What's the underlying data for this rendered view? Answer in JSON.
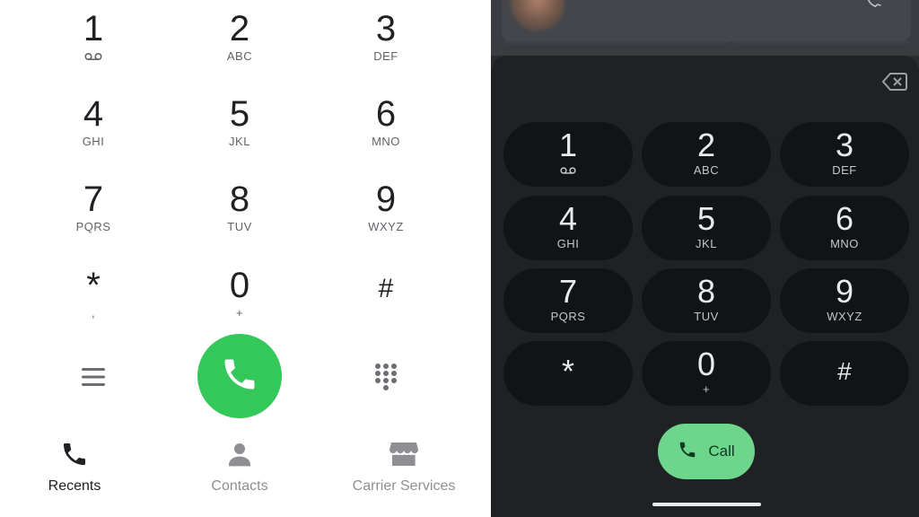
{
  "light_dialer": {
    "keys": [
      {
        "digit": "1",
        "letters": "",
        "icon": "voicemail-icon"
      },
      {
        "digit": "2",
        "letters": "ABC"
      },
      {
        "digit": "3",
        "letters": "DEF"
      },
      {
        "digit": "4",
        "letters": "GHI"
      },
      {
        "digit": "5",
        "letters": "JKL"
      },
      {
        "digit": "6",
        "letters": "MNO"
      },
      {
        "digit": "7",
        "letters": "PQRS"
      },
      {
        "digit": "8",
        "letters": "TUV"
      },
      {
        "digit": "9",
        "letters": "WXYZ"
      },
      {
        "digit": "*",
        "letters": ","
      },
      {
        "digit": "0",
        "letters": "+"
      },
      {
        "digit": "#",
        "letters": ""
      }
    ],
    "menu_icon": "menu-icon",
    "call_icon": "phone-icon",
    "keypad_icon": "keypad-icon",
    "tabs": [
      {
        "label": "Recents",
        "icon": "phone-icon",
        "active": true
      },
      {
        "label": "Contacts",
        "icon": "person-icon",
        "active": false
      },
      {
        "label": "Carrier Services",
        "icon": "store-icon",
        "active": false
      }
    ]
  },
  "dark_dialer": {
    "keys": [
      {
        "digit": "1",
        "letters": "",
        "icon": "voicemail-icon"
      },
      {
        "digit": "2",
        "letters": "ABC"
      },
      {
        "digit": "3",
        "letters": "DEF"
      },
      {
        "digit": "4",
        "letters": "GHI"
      },
      {
        "digit": "5",
        "letters": "JKL"
      },
      {
        "digit": "6",
        "letters": "MNO"
      },
      {
        "digit": "7",
        "letters": "PQRS"
      },
      {
        "digit": "8",
        "letters": "TUV"
      },
      {
        "digit": "9",
        "letters": "WXYZ"
      },
      {
        "digit": "*",
        "letters": ""
      },
      {
        "digit": "0",
        "letters": "+"
      },
      {
        "digit": "#",
        "letters": ""
      }
    ],
    "call_label": "Call",
    "backspace_icon": "backspace-icon"
  },
  "colors": {
    "light_call_green": "#34c759",
    "dark_call_green": "#6dd58c",
    "dark_key_bg": "#121316",
    "dark_panel_bg": "#1f2125"
  }
}
